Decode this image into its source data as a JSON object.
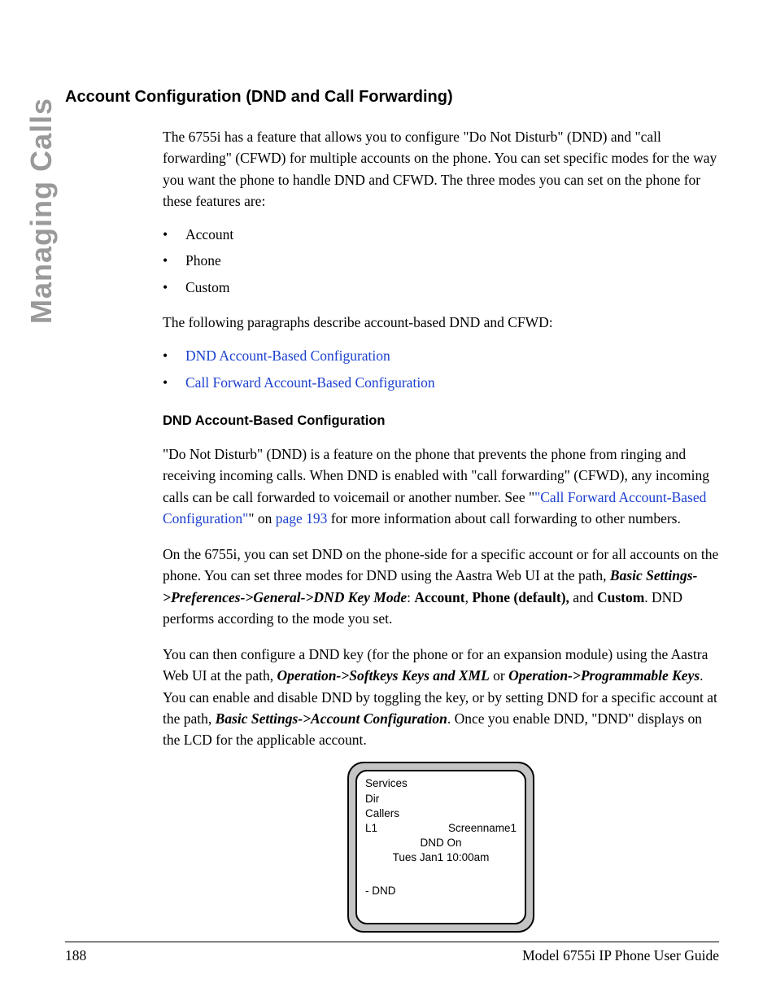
{
  "side_label": "Managing Calls",
  "heading": "Account Configuration (DND and Call Forwarding)",
  "intro_para": "The 6755i has a feature that allows you to configure \"Do Not Disturb\" (DND) and \"call forwarding\" (CFWD) for multiple accounts on the phone. You can set specific modes for the way you want the phone to handle DND and CFWD. The three modes you can set on the phone for these features are:",
  "modes": [
    "Account",
    "Phone",
    "Custom"
  ],
  "para2": "The following paragraphs describe account-based DND and CFWD:",
  "links": [
    "DND Account-Based Configuration",
    "Call Forward Account-Based Configuration"
  ],
  "subheading": "DND Account-Based Configuration",
  "para3": {
    "pre": "\"Do Not Disturb\" (DND) is a feature on the phone that prevents the phone from ringing and receiving incoming calls. When DND is enabled with \"call forwarding\" (CFWD), any incoming calls can be call forwarded to voicemail or another number. See \"",
    "link1": "\"Call Forward Account-Based Configuration\"",
    "mid": "\" on ",
    "link2": "page 193",
    "post": " for more information about call forwarding to other numbers."
  },
  "para4": {
    "pre": "On the 6755i, you can set DND on the phone-side for a specific account or for all accounts on the phone. You can set three modes for DND using the Aastra Web UI at the path, ",
    "path": "Basic Settings->Preferences->General->DND Key Mode",
    "mid1": ": ",
    "opt1": "Account",
    "mid2": ", ",
    "opt2": "Phone (default),",
    "mid3": " and ",
    "opt3": "Custom",
    "post": ". DND performs according to the mode you set."
  },
  "para5": {
    "pre": "You can then configure a DND key (for the phone or for an expansion module) using the Aastra Web UI at the path, ",
    "path1": "Operation->Softkeys Keys and XML",
    "mid1": " or ",
    "path2": "Operation->Programmable Keys",
    "mid2": ". You can enable and disable DND by toggling the key, or by setting DND for a specific account at the path, ",
    "path3": "Basic Settings->Account Configuration",
    "post": ". Once you enable DND, \"DND\" displays on the LCD for the applicable account."
  },
  "lcd": {
    "r1": "Services",
    "r2": "Dir",
    "r3": "Callers",
    "r4a": "L1",
    "r4b": "Screenname1",
    "r5": "DND On",
    "r6": "Tues Jan1 10:00am",
    "r7": "- DND"
  },
  "footer": {
    "page": "188",
    "guide": "Model 6755i IP Phone User Guide"
  }
}
